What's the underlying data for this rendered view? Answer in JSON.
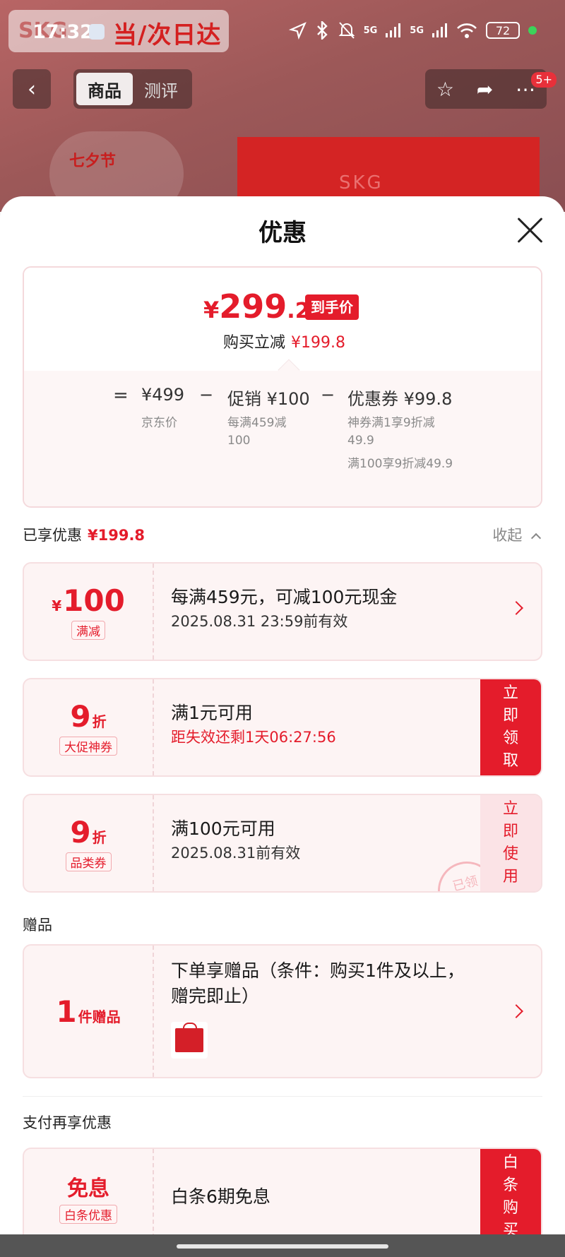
{
  "status_bar": {
    "time": "17:32",
    "signal1": "5G",
    "signal2": "5G",
    "battery": "72"
  },
  "background_page": {
    "banner_text": "当/次日达",
    "banner_brand": "SKG",
    "tabs": [
      "商品",
      "测评"
    ],
    "badge": "5+",
    "product_label": "SKG",
    "festival_logo": "七夕节"
  },
  "sheet": {
    "title": "优惠"
  },
  "summary": {
    "price_symbol": "¥",
    "price_int": "299",
    "price_dec": ".2",
    "price_tag": "到手价",
    "save_label": "购买立减",
    "save_value": "¥199.8",
    "formula": {
      "equals": "=",
      "jd_price": "¥499",
      "jd_label": "京东价",
      "minus1": "−",
      "promo": "促销 ¥100",
      "promo_desc": "每满459减100",
      "minus2": "−",
      "coupon": "优惠券 ¥99.8",
      "coupon_desc1": "神券满1享9折减49.9",
      "coupon_desc2": "满100享9折减49.9"
    }
  },
  "enjoyed": {
    "label": "已享优惠",
    "value": "¥199.8",
    "collapse": "收起"
  },
  "coupons": [
    {
      "symbol": "¥",
      "amount": "100",
      "unit": "",
      "chip": "满减",
      "title": "每满459元，可减100元现金",
      "sub": "2025.08.31 23:59前有效"
    },
    {
      "amount": "9",
      "unit": "折",
      "chip": "大促神券",
      "title": "满1元可用",
      "sub": "距失效还剩1天06:27:56",
      "action": "立即领取"
    },
    {
      "amount": "9",
      "unit": "折",
      "chip": "品类券",
      "title": "满100元可用",
      "sub": "2025.08.31前有效",
      "action": "立即使用",
      "stamp": "已领"
    }
  ],
  "gifts": {
    "section": "赠品",
    "amount": "1",
    "unit": "件赠品",
    "title": "下单享赠品（条件：购买1件及以上，赠完即止）"
  },
  "payment": {
    "section": "支付再享优惠",
    "big": "免息",
    "chip": "白条优惠",
    "title": "白条6期免息",
    "action": "白条购买"
  },
  "colors": {
    "accent": "#e41c2b",
    "card_bg": "#fdf4f4"
  }
}
